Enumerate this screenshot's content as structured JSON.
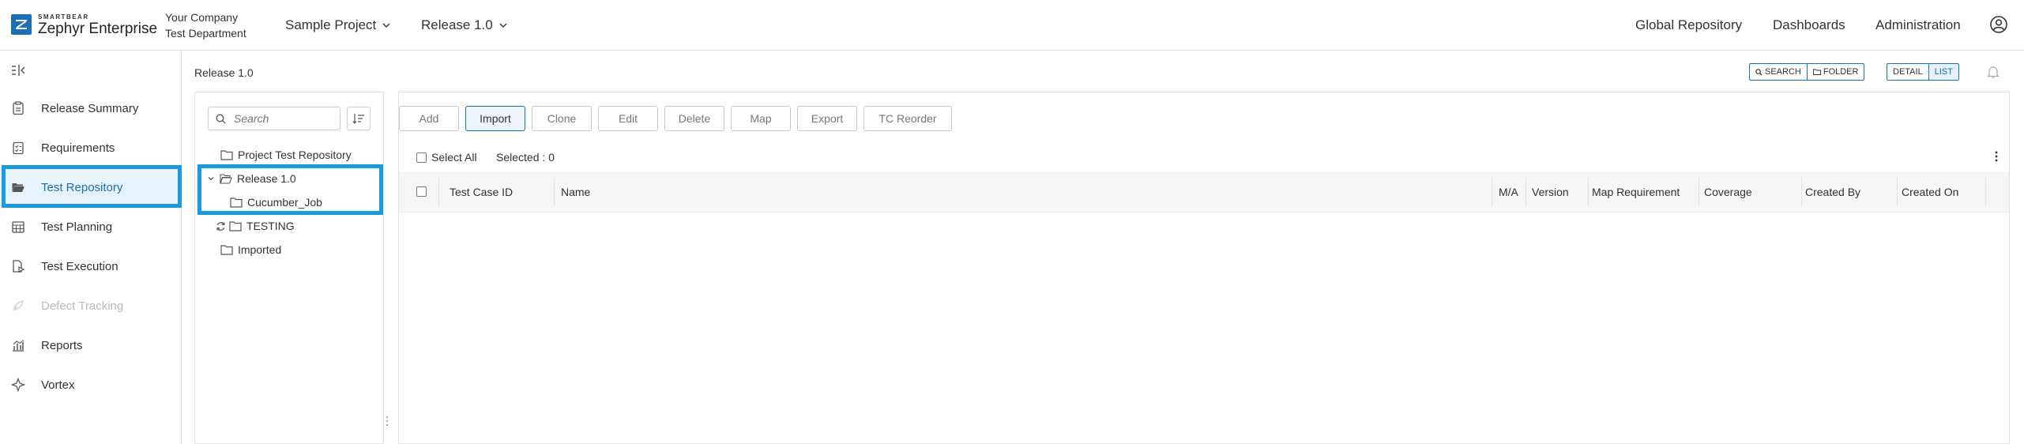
{
  "brand": {
    "small": "SMARTBEAR",
    "name": "Zephyr Enterprise",
    "color": "#1a6fb5"
  },
  "company": {
    "line1": "Your Company",
    "line2": "Test Department"
  },
  "topnav": {
    "project": "Sample Project",
    "release": "Release 1.0",
    "links": [
      "Global Repository",
      "Dashboards",
      "Administration"
    ]
  },
  "sidebar": {
    "items": [
      {
        "label": "Release Summary",
        "icon": "clipboard-icon"
      },
      {
        "label": "Requirements",
        "icon": "checklist-icon"
      },
      {
        "label": "Test Repository",
        "icon": "folder-open-icon",
        "active": true
      },
      {
        "label": "Test Planning",
        "icon": "calendar-icon"
      },
      {
        "label": "Test Execution",
        "icon": "play-doc-icon"
      },
      {
        "label": "Defect Tracking",
        "icon": "bug-icon",
        "disabled": true
      },
      {
        "label": "Reports",
        "icon": "chart-icon"
      },
      {
        "label": "Vortex",
        "icon": "vortex-icon"
      }
    ]
  },
  "breadcrumb": "Release 1.0",
  "view_toggles": {
    "search": "SEARCH",
    "folder": "FOLDER",
    "detail": "DETAIL",
    "list": "LIST",
    "active_view": "LIST"
  },
  "tree": {
    "search_placeholder": "Search",
    "nodes": {
      "project_repo": "Project Test Repository",
      "release": "Release 1.0",
      "cucumber": "Cucumber_Job",
      "testing": "TESTING",
      "imported": "Imported"
    }
  },
  "toolbar": {
    "add": "Add",
    "import": "Import",
    "clone": "Clone",
    "edit": "Edit",
    "delete": "Delete",
    "map": "Map",
    "export": "Export",
    "reorder": "TC Reorder"
  },
  "selection": {
    "select_all": "Select All",
    "selected": "Selected : 0"
  },
  "table": {
    "columns": {
      "id": "Test Case ID",
      "name": "Name",
      "ma": "M/A",
      "version": "Version",
      "map_req": "Map Requirement",
      "coverage": "Coverage",
      "created_by": "Created By",
      "created_on": "Created On"
    },
    "rows": []
  },
  "colors": {
    "accent": "#1a6fb5",
    "highlight": "#1a9bdc"
  }
}
